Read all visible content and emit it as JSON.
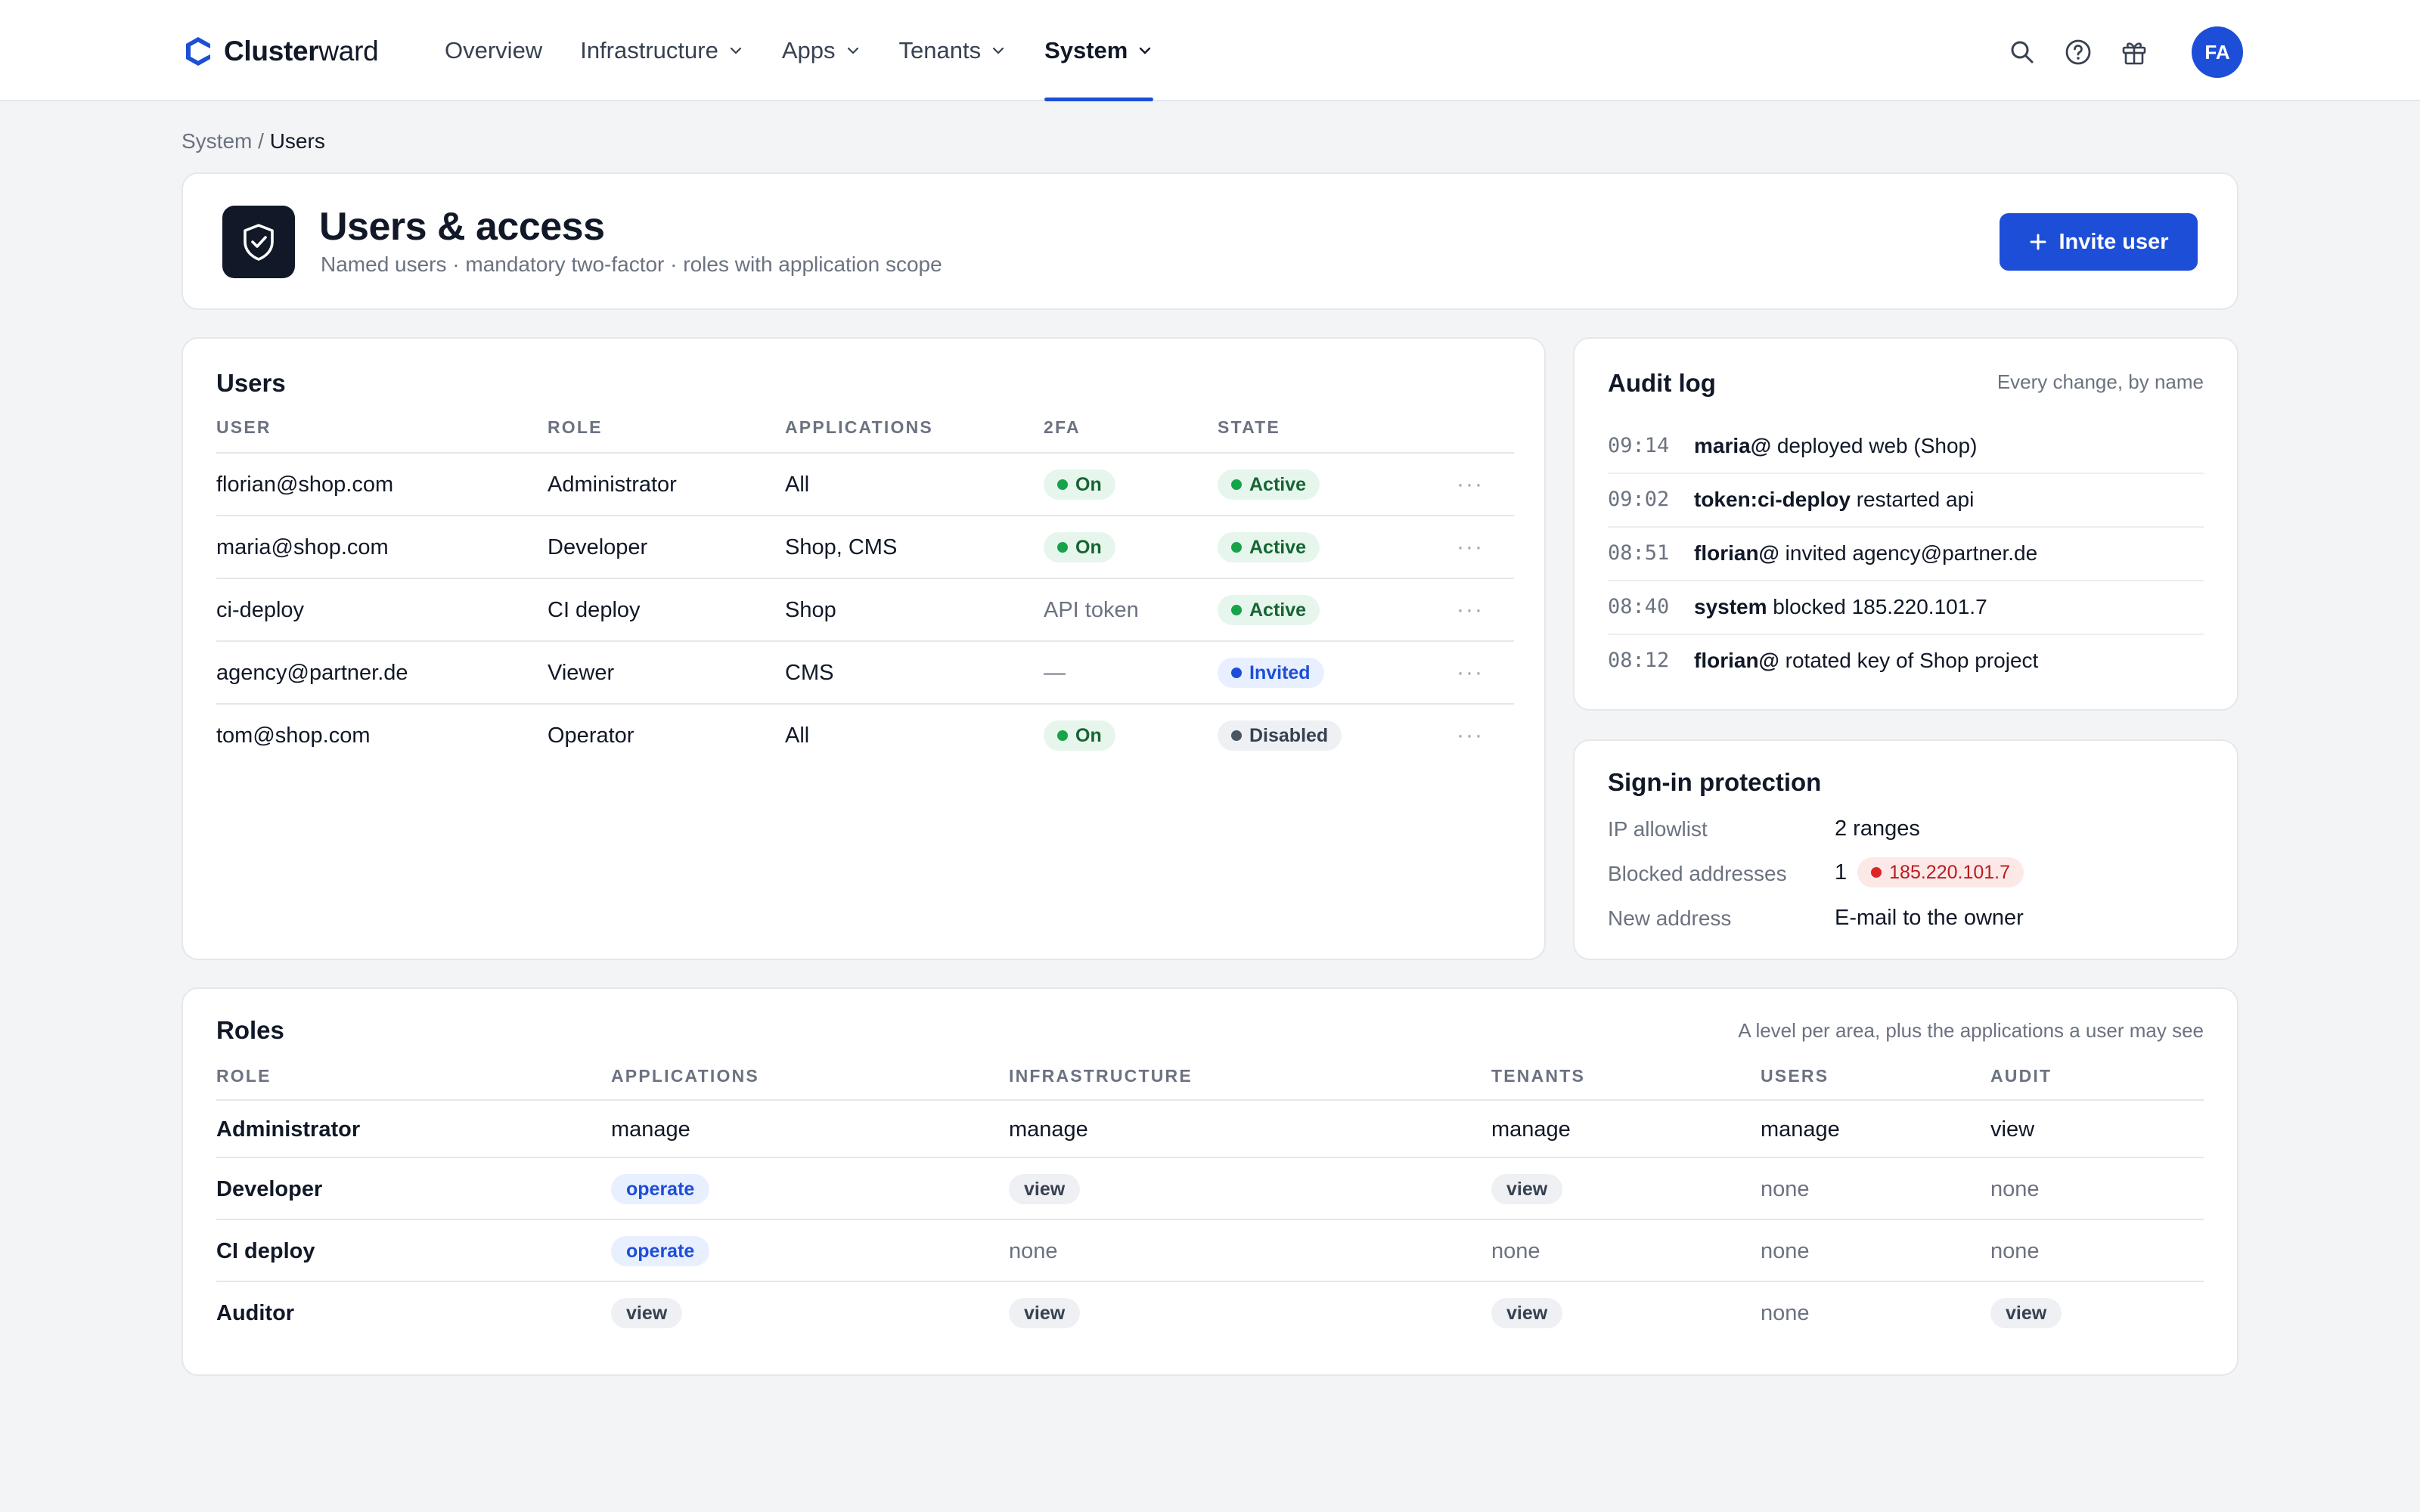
{
  "app": {
    "name_bold": "Cluster",
    "name_light": "ward"
  },
  "nav": [
    {
      "label": "Overview",
      "has_menu": false,
      "active": false
    },
    {
      "label": "Infrastructure",
      "has_menu": true,
      "active": false
    },
    {
      "label": "Apps",
      "has_menu": true,
      "active": false
    },
    {
      "label": "Tenants",
      "has_menu": true,
      "active": false
    },
    {
      "label": "System",
      "has_menu": true,
      "active": true
    }
  ],
  "user": {
    "initials": "FA"
  },
  "breadcrumb": {
    "parent": "System",
    "separator": " / ",
    "current": "Users"
  },
  "header": {
    "title": "Users & access",
    "subtitle": "Named users · mandatory two-factor · roles with application scope",
    "invite_label": "Invite user"
  },
  "users": {
    "title": "Users",
    "columns": [
      "USER",
      "ROLE",
      "APPLICATIONS",
      "2FA",
      "STATE"
    ],
    "rows": [
      {
        "user": "florian@shop.com",
        "role": "Administrator",
        "apps": "All",
        "twofa": "On",
        "twofa_type": "pill",
        "state": "Active",
        "state_color": "green"
      },
      {
        "user": "maria@shop.com",
        "role": "Developer",
        "apps": "Shop, CMS",
        "twofa": "On",
        "twofa_type": "pill",
        "state": "Active",
        "state_color": "green"
      },
      {
        "user": "ci-deploy",
        "role": "CI deploy",
        "apps": "Shop",
        "twofa": "API token",
        "twofa_type": "text",
        "state": "Active",
        "state_color": "green"
      },
      {
        "user": "agency@partner.de",
        "role": "Viewer",
        "apps": "CMS",
        "twofa": "—",
        "twofa_type": "text",
        "state": "Invited",
        "state_color": "blue"
      },
      {
        "user": "tom@shop.com",
        "role": "Operator",
        "apps": "All",
        "twofa": "On",
        "twofa_type": "pill",
        "state": "Disabled",
        "state_color": "gray"
      }
    ],
    "more_label": "···"
  },
  "audit": {
    "title": "Audit log",
    "caption": "Every change, by name",
    "entries": [
      {
        "time": "09:14",
        "actor": "maria@",
        "text": "deployed web (Shop)"
      },
      {
        "time": "09:02",
        "actor": "token:ci-deploy",
        "text": "restarted api"
      },
      {
        "time": "08:51",
        "actor": "florian@",
        "text": "invited agency@partner.de"
      },
      {
        "time": "08:40",
        "actor": "system",
        "text": "blocked 185.220.101.7"
      },
      {
        "time": "08:12",
        "actor": "florian@",
        "text": "rotated key of Shop project"
      }
    ]
  },
  "signin": {
    "title": "Sign-in protection",
    "ip_allowlist_label": "IP allowlist",
    "ip_allowlist_value": "2 ranges",
    "blocked_label": "Blocked addresses",
    "blocked_count": "1",
    "blocked_ip": "185.220.101.7",
    "new_address_label": "New address",
    "new_address_value": "E-mail to the owner"
  },
  "roles": {
    "title": "Roles",
    "caption": "A level per area, plus the applications a user may see",
    "columns": [
      "ROLE",
      "APPLICATIONS",
      "INFRASTRUCTURE",
      "TENANTS",
      "USERS",
      "AUDIT"
    ],
    "rows": [
      {
        "role": "Administrator",
        "levels": [
          {
            "v": "manage",
            "s": "text"
          },
          {
            "v": "manage",
            "s": "text"
          },
          {
            "v": "manage",
            "s": "text"
          },
          {
            "v": "manage",
            "s": "text"
          },
          {
            "v": "view",
            "s": "text"
          }
        ]
      },
      {
        "role": "Developer",
        "levels": [
          {
            "v": "operate",
            "s": "blue"
          },
          {
            "v": "view",
            "s": "gray"
          },
          {
            "v": "view",
            "s": "gray"
          },
          {
            "v": "none",
            "s": "muted"
          },
          {
            "v": "none",
            "s": "muted"
          }
        ]
      },
      {
        "role": "CI deploy",
        "levels": [
          {
            "v": "operate",
            "s": "blue"
          },
          {
            "v": "none",
            "s": "muted"
          },
          {
            "v": "none",
            "s": "muted"
          },
          {
            "v": "none",
            "s": "muted"
          },
          {
            "v": "none",
            "s": "muted"
          }
        ]
      },
      {
        "role": "Auditor",
        "levels": [
          {
            "v": "view",
            "s": "gray"
          },
          {
            "v": "view",
            "s": "gray"
          },
          {
            "v": "view",
            "s": "gray"
          },
          {
            "v": "none",
            "s": "muted"
          },
          {
            "v": "view",
            "s": "gray"
          }
        ]
      }
    ]
  },
  "colors": {
    "accent": "#1d4ed8",
    "active_green": "#16a34a",
    "blocked_red": "#dc2626",
    "dark": "#111827"
  }
}
